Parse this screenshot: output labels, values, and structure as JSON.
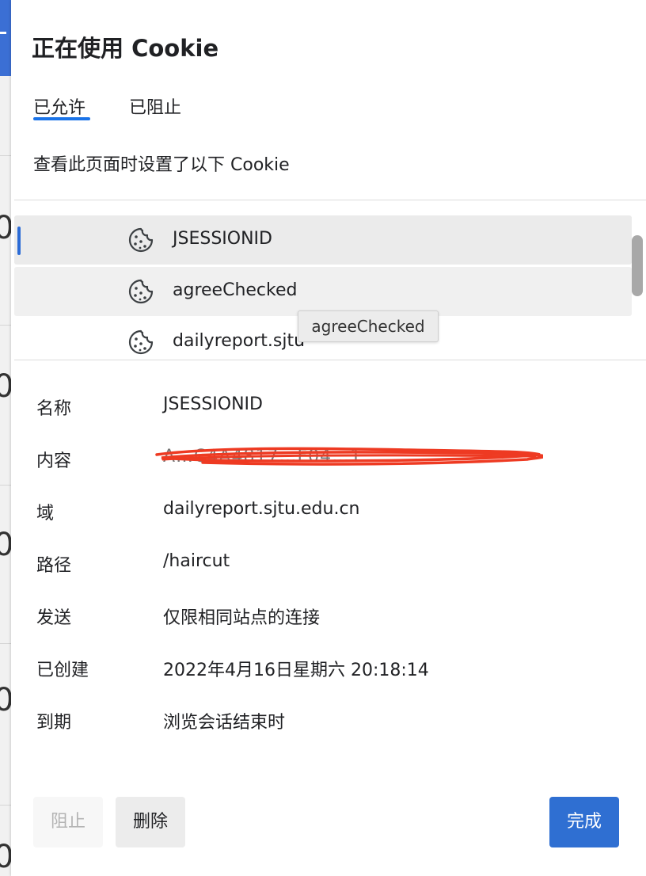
{
  "dialog": {
    "title": "正在使用 Cookie",
    "tabs": [
      {
        "label": "已允许",
        "active": true
      },
      {
        "label": "已阻止",
        "active": false
      }
    ],
    "description": "查看此页面时设置了以下 Cookie"
  },
  "cookie_list": {
    "items": [
      {
        "name": "JSESSIONID",
        "icon": "cookie-icon",
        "selected": true
      },
      {
        "name": "agreeChecked",
        "icon": "cookie-icon",
        "hovered": true
      },
      {
        "name": "dailyreport.sjtu",
        "icon": "cookie-icon"
      }
    ],
    "tooltip": "agreeChecked"
  },
  "details": {
    "name_label": "名称",
    "name_value": "JSESSIONID",
    "content_label": "内容",
    "content_value": "A…C4A4817…F04…1…",
    "domain_label": "域",
    "domain_value": "dailyreport.sjtu.edu.cn",
    "path_label": "路径",
    "path_value": "/haircut",
    "send_label": "发送",
    "send_value": "仅限相同站点的连接",
    "created_label": "已创建",
    "created_value": "2022年4月16日星期六 20:18:14",
    "expires_label": "到期",
    "expires_value": "浏览会话结束时"
  },
  "buttons": {
    "block": "阻止",
    "delete": "删除",
    "done": "完成"
  },
  "colors": {
    "accent": "#1a73e8",
    "primary_button": "#2f6fd2",
    "redaction": "#ee3a22"
  }
}
